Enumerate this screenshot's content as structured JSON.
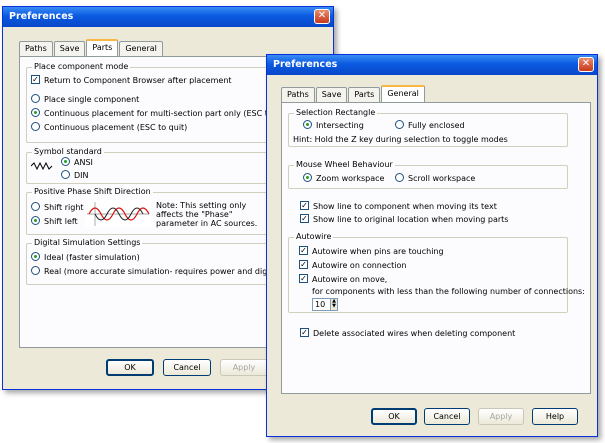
{
  "back_dialog": {
    "title": "Preferences",
    "tabs": [
      "Paths",
      "Save",
      "Parts",
      "General"
    ],
    "active_tab": "Parts",
    "place_mode": {
      "legend": "Place component mode",
      "return_browser": "Return to Component Browser after placement",
      "single": "Place single component",
      "continuous_multi": "Continuous placement for multi-section part only (ESC to quit)",
      "continuous": "Continuous placement (ESC to quit)"
    },
    "symbol": {
      "legend": "Symbol standard",
      "ansi": "ANSI",
      "din": "DIN"
    },
    "phase": {
      "legend": "Positive Phase Shift Direction",
      "right": "Shift right",
      "left": "Shift left",
      "note": "Note: This setting only affects the \"Phase\" parameter in AC sources."
    },
    "digital": {
      "legend": "Digital Simulation Settings",
      "ideal": "Ideal (faster simulation)",
      "real": "Real (more accurate simulation- requires power and digital ground)"
    },
    "buttons": {
      "ok": "OK",
      "cancel": "Cancel",
      "apply": "Apply"
    }
  },
  "front_dialog": {
    "title": "Preferences",
    "tabs": [
      "Paths",
      "Save",
      "Parts",
      "General"
    ],
    "active_tab": "General",
    "selection": {
      "legend": "Selection Rectangle",
      "intersecting": "Intersecting",
      "enclosed": "Fully enclosed",
      "hint": "Hint: Hold the Z key during selection to toggle modes"
    },
    "mouse": {
      "legend": "Mouse Wheel Behaviour",
      "zoom": "Zoom workspace",
      "scroll": "Scroll workspace"
    },
    "show_line_text": "Show line to component when moving its text",
    "show_line_origin": "Show line to original location when moving parts",
    "autowire": {
      "legend": "Autowire",
      "pins_touching": "Autowire when pins are touching",
      "on_connection": "Autowire on connection",
      "on_move": "Autowire on move,",
      "on_move_sub": "for components with less than the following number of connections:",
      "connections": "10"
    },
    "delete_wires": "Delete associated wires when deleting component",
    "buttons": {
      "ok": "OK",
      "cancel": "Cancel",
      "apply": "Apply",
      "help": "Help"
    }
  },
  "colors": {
    "title_bar": "#0a5ae0",
    "dialog_bg": "#ece9d8",
    "check": "#21a121"
  },
  "icons": {
    "close": "close-icon",
    "wave": "sine-wave-icon",
    "phase_graph": "phase-shift-graph-icon"
  }
}
